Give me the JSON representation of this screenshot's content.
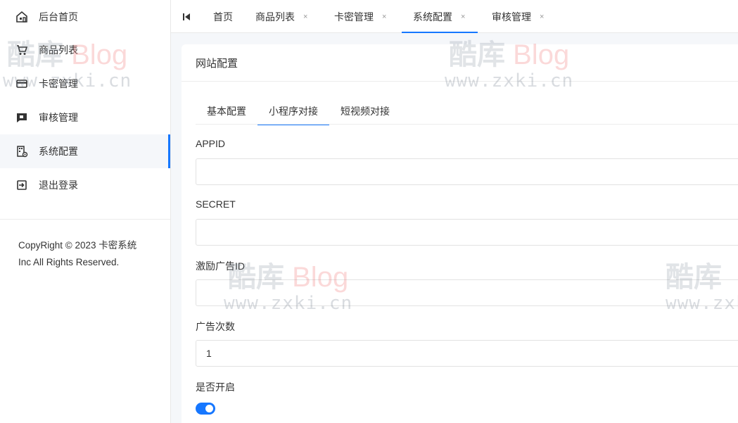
{
  "sidebar": {
    "items": [
      {
        "label": "后台首页",
        "icon": "home-icon"
      },
      {
        "label": "商品列表",
        "icon": "cart-icon"
      },
      {
        "label": "卡密管理",
        "icon": "card-icon"
      },
      {
        "label": "审核管理",
        "icon": "review-icon"
      },
      {
        "label": "系统配置",
        "icon": "settings-building-icon",
        "active": true
      },
      {
        "label": "退出登录",
        "icon": "logout-icon"
      }
    ],
    "copyright_line1": "CopyRight © 2023 卡密系统",
    "copyright_line2": "Inc All Rights Reserved."
  },
  "tabbar": {
    "tabs": [
      {
        "label": "首页",
        "closable": false
      },
      {
        "label": "商品列表",
        "closable": true
      },
      {
        "label": "卡密管理",
        "closable": true
      },
      {
        "label": "系统配置",
        "closable": true,
        "active": true
      },
      {
        "label": "审核管理",
        "closable": true
      }
    ],
    "close_glyph": "×"
  },
  "card": {
    "title": "网站配置",
    "subtabs": [
      {
        "label": "基本配置"
      },
      {
        "label": "小程序对接",
        "active": true
      },
      {
        "label": "短视频对接"
      }
    ],
    "fields": [
      {
        "label": "APPID",
        "value": ""
      },
      {
        "label": "SECRET",
        "value": ""
      },
      {
        "label": "激励广告ID",
        "value": ""
      },
      {
        "label": "广告次数",
        "value": "1"
      }
    ],
    "switch_label": "是否开启",
    "switch_on": true
  },
  "watermark": {
    "brand_cn": "酷库",
    "brand_en": "Blog",
    "url": "www.zxki.cn"
  },
  "colors": {
    "accent": "#1677ff"
  }
}
